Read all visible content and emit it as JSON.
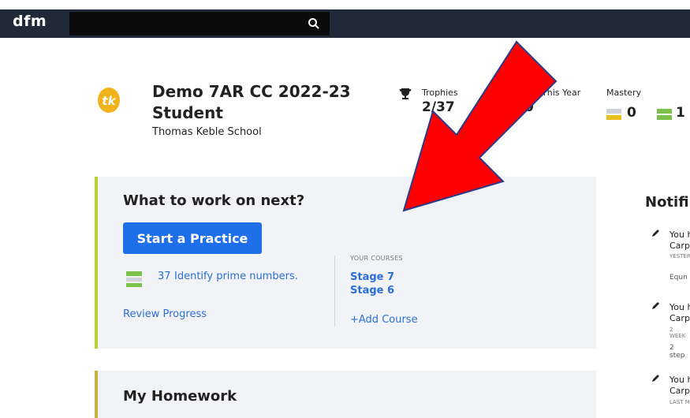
{
  "header": {
    "logo": "dfm",
    "search_placeholder": ""
  },
  "profile": {
    "name": "Demo 7AR CC 2022-23 Student",
    "school": "Thomas Keble School"
  },
  "stats": {
    "trophies_label": "Trophies",
    "trophies_value": "2/37",
    "this_year_label": "This Year",
    "this_year_value": "0",
    "mastery_label": "Mastery",
    "mastery_yellow": "0",
    "mastery_green": "1"
  },
  "next": {
    "title": "What to work on next?",
    "start_button": "Start a Practice",
    "skill_count": "37",
    "skill_name": "Identify prime numbers.",
    "review": "Review Progress",
    "courses_label": "YOUR COURSES",
    "courses": [
      "Stage 7",
      "Stage 6"
    ],
    "add_course": "+Add Course"
  },
  "homework": {
    "title": "My Homework"
  },
  "notifications": {
    "title": "Notifi",
    "items": [
      {
        "line1": "You h",
        "line2": "Carp",
        "time": "YESTER",
        "sub": "Equn"
      },
      {
        "line1": "You h",
        "line2": "Carp",
        "time": "2 WEEK",
        "sub": "2 step"
      },
      {
        "line1": "You h",
        "line2": "Carp",
        "time": "LAST M",
        "sub": ""
      }
    ]
  },
  "colors": {
    "topbar": "#1f2937",
    "accent": "#1f6feb",
    "arrow": "#ff0000",
    "panel_border": "#b7d332"
  }
}
